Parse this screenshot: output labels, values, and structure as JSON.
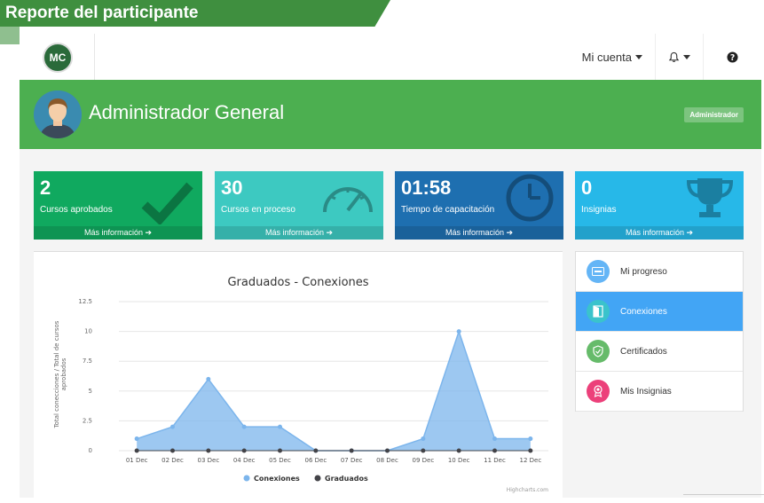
{
  "banner": {
    "title": "Reporte del participante"
  },
  "navbar": {
    "logo_text": "MC",
    "account_label": "Mi cuenta",
    "bell_icon": "bell-icon",
    "help_icon": "question-icon"
  },
  "header": {
    "name": "Administrador General",
    "role": "Administrador"
  },
  "stats": [
    {
      "value": "2",
      "label": "Cursos aprobados",
      "link": "Más información",
      "color": "#10a95f",
      "icon": "check-icon"
    },
    {
      "value": "30",
      "label": "Cursos en proceso",
      "link": "Más información",
      "color": "#3dc9c1",
      "icon": "speedometer-icon"
    },
    {
      "value": "01:58",
      "label": "Tiempo de capacitación",
      "link": "Más información",
      "color": "#1e6fb0",
      "icon": "clock-icon"
    },
    {
      "value": "0",
      "label": "Insignias",
      "link": "Más información",
      "color": "#27b8e8",
      "icon": "trophy-icon"
    }
  ],
  "menu": [
    {
      "label": "Mi progreso",
      "icon": "progress-icon",
      "color": "#64b5f6",
      "active": false
    },
    {
      "label": "Conexiones",
      "icon": "door-icon",
      "color": "#3ac3cc",
      "active": true
    },
    {
      "label": "Certificados",
      "icon": "shield-check-icon",
      "color": "#66bb6a",
      "active": false
    },
    {
      "label": "Mis Insignias",
      "icon": "badge-icon",
      "color": "#ec407a",
      "active": false
    }
  ],
  "chart_data": {
    "type": "area",
    "title": "Graduados - Conexiones",
    "ylabel": "Total conecciones / Total de cursos aprobados",
    "xlabel": "",
    "categories": [
      "01 Dec",
      "02 Dec",
      "03 Dec",
      "04 Dec",
      "05 Dec",
      "06 Dec",
      "07 Dec",
      "08 Dec",
      "09 Dec",
      "10 Dec",
      "11 Dec",
      "12 Dec"
    ],
    "ylim": [
      0,
      12.5
    ],
    "yticks": [
      "0",
      "2.5",
      "5",
      "7.5",
      "10",
      "12.5"
    ],
    "series": [
      {
        "name": "Conexiones",
        "values": [
          1,
          2,
          6,
          2,
          2,
          0,
          0,
          0,
          1,
          10,
          1,
          1
        ],
        "color": "#7cb5ec"
      },
      {
        "name": "Graduados",
        "values": [
          0,
          0,
          0,
          0,
          0,
          0,
          0,
          0,
          0,
          0,
          0,
          0
        ],
        "color": "#434348"
      }
    ],
    "legend": "bottom",
    "credits": "Highcharts.com"
  }
}
